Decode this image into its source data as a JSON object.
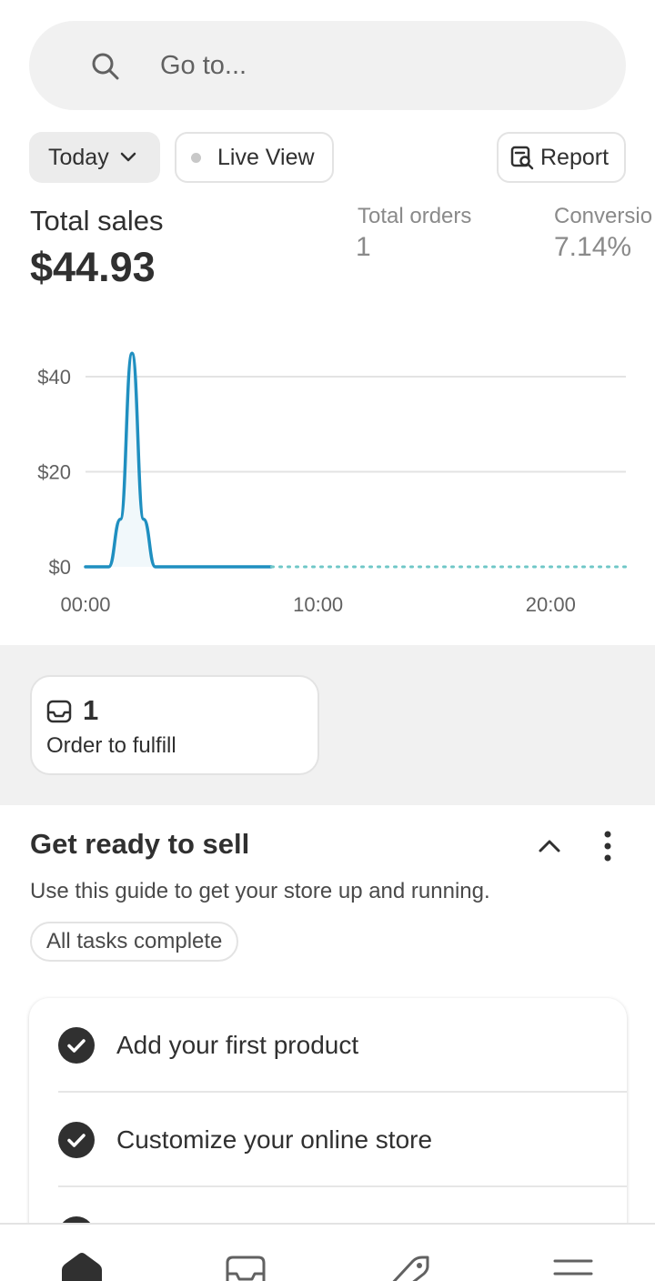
{
  "search": {
    "placeholder": "Go to..."
  },
  "filters": {
    "date_label": "Today",
    "live_view_label": "Live View",
    "report_label": "Report"
  },
  "metrics": {
    "total_sales": {
      "label": "Total sales",
      "value": "$44.93"
    },
    "total_orders": {
      "label": "Total orders",
      "value": "1"
    },
    "conversion": {
      "label": "Conversion rate",
      "label_visible": "Conversio",
      "value": "7.14%"
    }
  },
  "chart_data": {
    "type": "line",
    "x_tick_labels": [
      "00:00",
      "10:00",
      "20:00"
    ],
    "y_tick_labels": [
      "$0",
      "$20",
      "$40"
    ],
    "ylim": [
      0,
      45
    ],
    "xlim_hours": [
      0,
      23
    ],
    "series": [
      {
        "x_hours": [
          0,
          1,
          1.5,
          2,
          2.5,
          3,
          4,
          5,
          6,
          7,
          8
        ],
        "values": [
          0,
          0,
          10,
          44.93,
          10,
          0,
          0,
          0,
          0,
          0,
          0
        ],
        "style": "solid",
        "color": "#1f8fc0"
      },
      {
        "x_hours": [
          8,
          23
        ],
        "values": [
          0,
          0
        ],
        "style": "dotted",
        "color": "#6fc7c7"
      }
    ],
    "grid": true,
    "legend": "none"
  },
  "fulfill": {
    "count": "1",
    "label": "Order to fulfill"
  },
  "get_ready": {
    "title": "Get ready to sell",
    "description": "Use this guide to get your store up and running.",
    "badge": "All tasks complete",
    "tasks": [
      {
        "label": "Add your first product",
        "done": true
      },
      {
        "label": "Customize your online store",
        "done": true
      },
      {
        "label": "",
        "done": true
      }
    ]
  },
  "bottom_nav": {
    "items": [
      {
        "icon": "home-icon"
      },
      {
        "icon": "orders-icon"
      },
      {
        "icon": "tag-icon"
      },
      {
        "icon": "menu-icon"
      }
    ]
  },
  "colors": {
    "accent_line": "#1f8fc0",
    "comparison_line": "#6fc7c7",
    "background_band": "#f1f1f1"
  }
}
